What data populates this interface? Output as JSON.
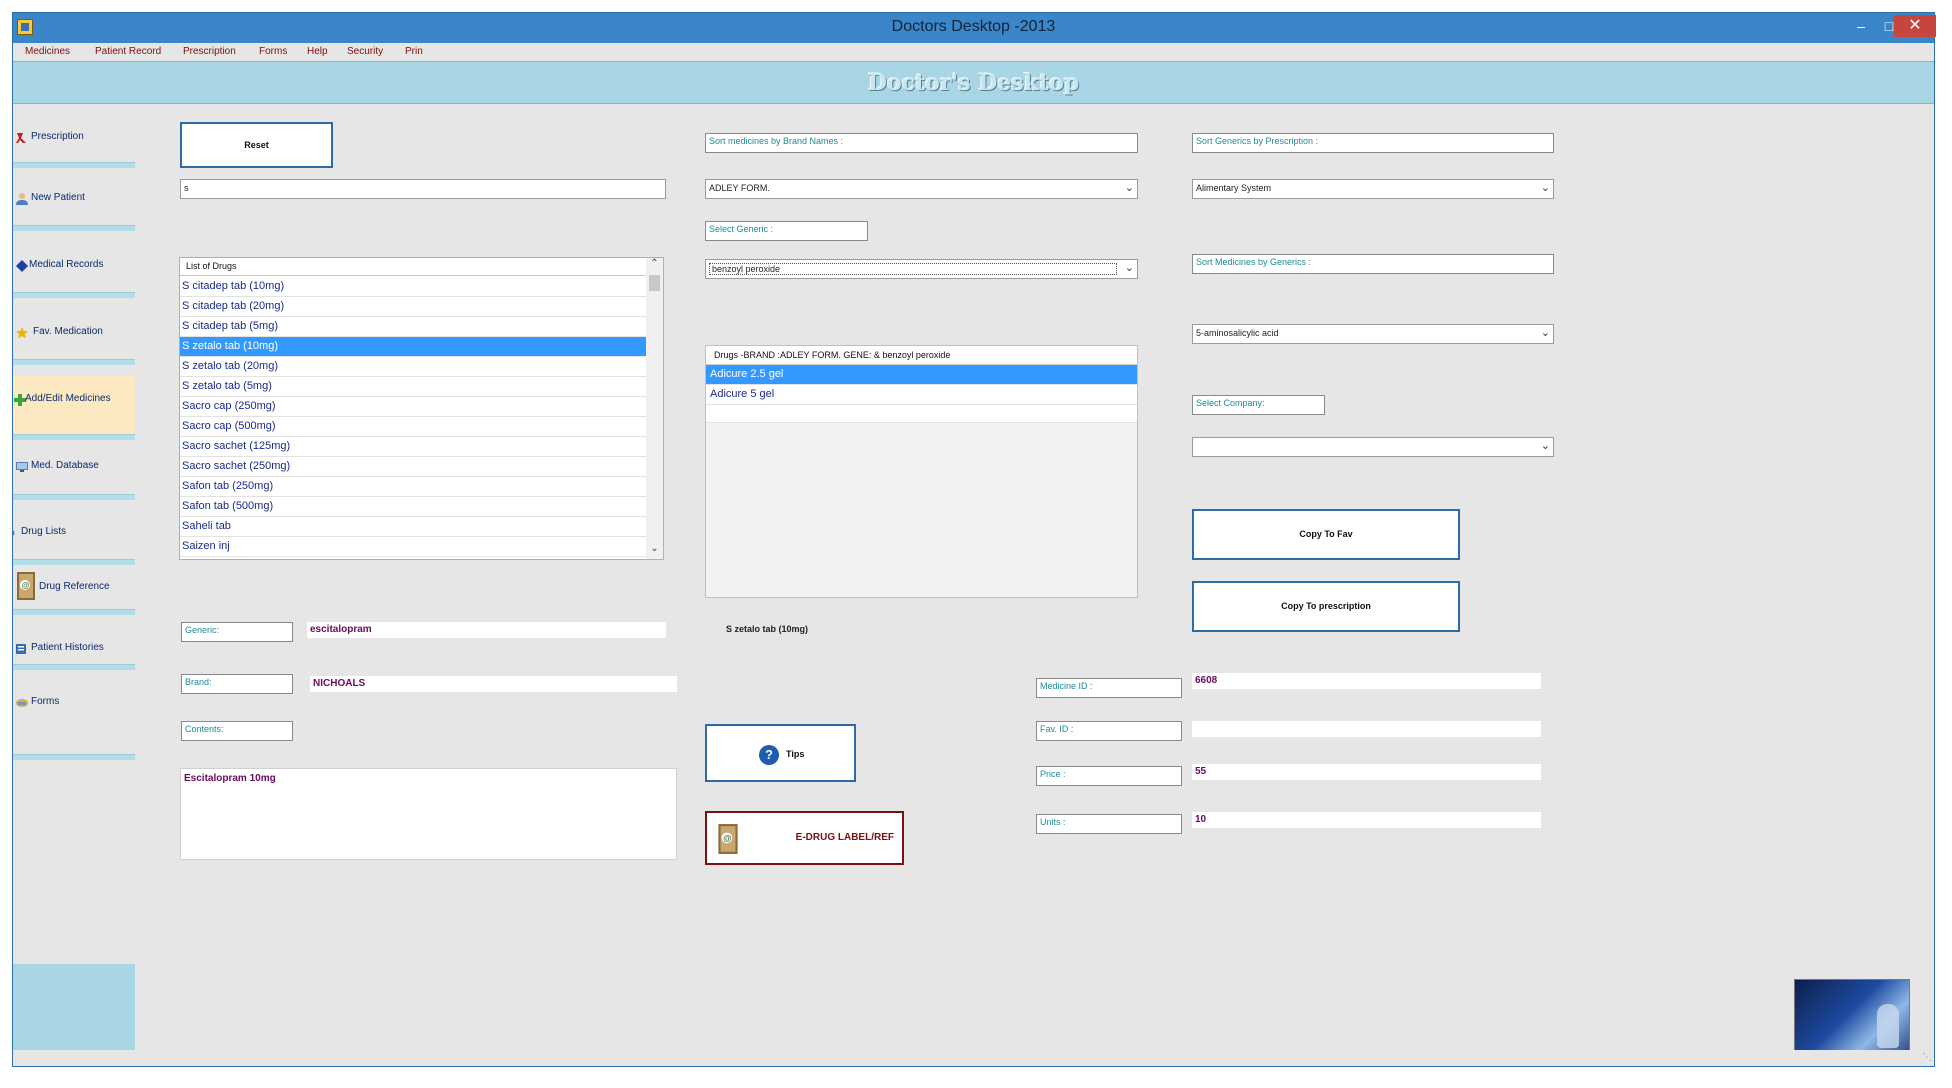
{
  "window": {
    "title": "Doctors Desktop -2013"
  },
  "menu": [
    "Medicines",
    "Patient Record",
    "Prescription",
    "Forms",
    "Help",
    "Security",
    "Prin"
  ],
  "banner": {
    "title": "Doctor's Desktop"
  },
  "sidebar": {
    "items": [
      {
        "label": "Prescription",
        "icon": "prescription-icon"
      },
      {
        "label": "New Patient",
        "icon": "new-patient-icon"
      },
      {
        "label": "Medical Records",
        "icon": "medical-records-icon"
      },
      {
        "label": "Fav. Medication",
        "icon": "star-icon"
      },
      {
        "label": "Add/Edit  Medicines",
        "icon": "plus-icon"
      },
      {
        "label": "Med. Database",
        "icon": "monitor-icon"
      },
      {
        "label": "Drug Lists",
        "icon": "list-icon"
      },
      {
        "label": "Drug Reference",
        "icon": "drug-reference-icon"
      },
      {
        "label": "Patient Histories",
        "icon": "patient-histories-icon"
      },
      {
        "label": "Forms",
        "icon": "forms-icon"
      }
    ],
    "active": "Med. Database"
  },
  "left": {
    "reset_label": "Reset",
    "search_value": "s",
    "list_header": "List of Drugs",
    "drugs": [
      "S citadep tab  (10mg)",
      "S citadep tab  (20mg)",
      "S citadep tab  (5mg)",
      "S zetalo tab  (10mg)",
      "S zetalo tab  (20mg)",
      "S zetalo tab  (5mg)",
      "Sacro cap  (250mg)",
      "Sacro cap  (500mg)",
      "Sacro sachet  (125mg)",
      "Sacro sachet  (250mg)",
      "Safon tab  (250mg)",
      "Safon tab  (500mg)",
      "Saheli tab",
      "Saizen inj"
    ],
    "selected_drug": "S zetalo tab  (10mg)",
    "generic_label": "Generic:",
    "generic_value": "escitalopram",
    "brand_label": "Brand:",
    "brand_value": "NICHOALS",
    "contents_label": "Contents:",
    "contents_value": "Escitalopram 10mg"
  },
  "middle": {
    "sort_brand_label": "Sort medicines by Brand Names :",
    "brand_combo_value": "ADLEY FORM.",
    "select_generic_label": "Select Generic :",
    "generic_combo_value": "benzoyl peroxide",
    "brands_header": "Drugs -BRAND :ADLEY FORM. GENE: & benzoyl peroxide",
    "brands": [
      "Adicure 2.5 gel",
      "Adicure 5 gel"
    ],
    "selected_brand": "Adicure 2.5 gel",
    "selected_drug_caption": "S zetalo tab (10mg)",
    "tips_label": "Tips",
    "edrug_label": "E-DRUG LABEL/REF"
  },
  "right": {
    "sort_generics_label": "Sort Generics by Prescription :",
    "system_combo_value": "Alimentary System",
    "sort_by_generics_label": "Sort Medicines by Generics :",
    "generic2_combo_value": "5-aminosalicylic acid",
    "select_company_label": "Select Company:",
    "company_combo_value": "",
    "copy_fav_label": "Copy To Fav",
    "copy_prescription_label": "Copy To prescription",
    "medicine_id_label": "Medicine ID :",
    "medicine_id_value": "6608",
    "fav_id_label": "Fav. ID :",
    "fav_id_value": "",
    "price_label": "Price  :",
    "price_value": "55",
    "units_label": "Units  :",
    "units_value": "10"
  },
  "colors": {
    "accent": "#3a86c8",
    "banner": "#a9d6e5",
    "selection": "#3399ff",
    "value_text": "#6a0a5a"
  }
}
